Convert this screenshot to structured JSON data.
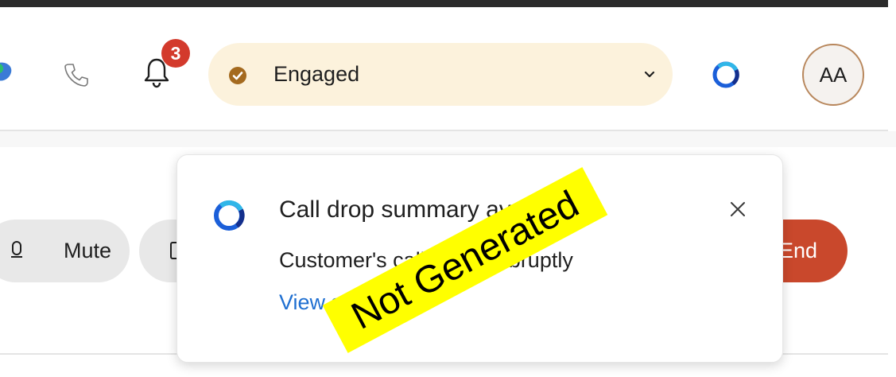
{
  "toolbar": {
    "notifications_count": "3",
    "status": {
      "label": "Engaged",
      "color": "#a46a1f",
      "background": "#fcf2dc"
    },
    "avatar_initials": "AA"
  },
  "call_controls": {
    "mute_label": "Mute",
    "end_label": "End",
    "end_color": "#c9482c"
  },
  "toast": {
    "title": "Call drop summary available",
    "body": "Customer's call ended abruptly",
    "link": "View summary",
    "link_color": "#1f6fd1"
  },
  "stamp": {
    "text": "Not Generated"
  }
}
